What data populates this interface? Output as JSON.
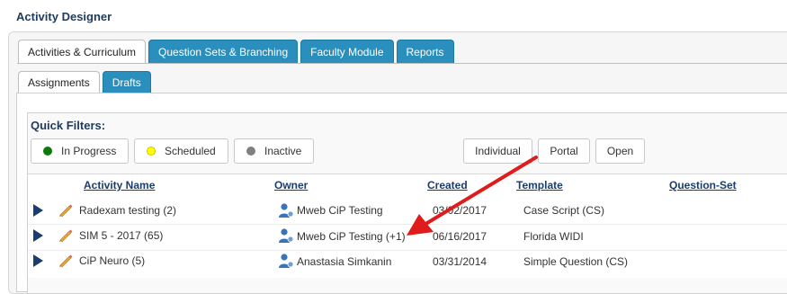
{
  "app": {
    "title": "Activity Designer"
  },
  "main_tabs": [
    {
      "label": "Activities & Curriculum",
      "active": true
    },
    {
      "label": "Question Sets & Branching",
      "active": false
    },
    {
      "label": "Faculty Module",
      "active": false
    },
    {
      "label": "Reports",
      "active": false
    }
  ],
  "sub_tabs": [
    {
      "label": "Assignments",
      "active": true
    },
    {
      "label": "Drafts",
      "active": false
    }
  ],
  "quick_filters": {
    "label": "Quick Filters:",
    "status": [
      {
        "label": "In Progress",
        "color": "#0a7a0a"
      },
      {
        "label": "Scheduled",
        "color": "#ffff00"
      },
      {
        "label": "Inactive",
        "color": "#808080"
      }
    ],
    "type": [
      "Individual",
      "Portal",
      "Open"
    ]
  },
  "table": {
    "columns": {
      "name": "Activity Name",
      "owner": "Owner",
      "created": "Created",
      "template": "Template",
      "question_set": "Question-Set"
    },
    "rows": [
      {
        "name": "Radexam testing (2)",
        "owner": "Mweb CiP Testing",
        "created": "03/02/2017",
        "template": "Case Script (CS)"
      },
      {
        "name": "SIM 5 - 2017 (65)",
        "owner": "Mweb CiP Testing (+1)",
        "created": "06/16/2017",
        "template": "Florida WIDI"
      },
      {
        "name": "CiP Neuro (5)",
        "owner": "Anastasia Simkanin",
        "created": "03/31/2014",
        "template": "Simple Question (CS)"
      }
    ]
  },
  "colors": {
    "accent_tab": "#2a8fbd",
    "header_link": "#1a3d6e",
    "arrow": "#e01b1b"
  }
}
